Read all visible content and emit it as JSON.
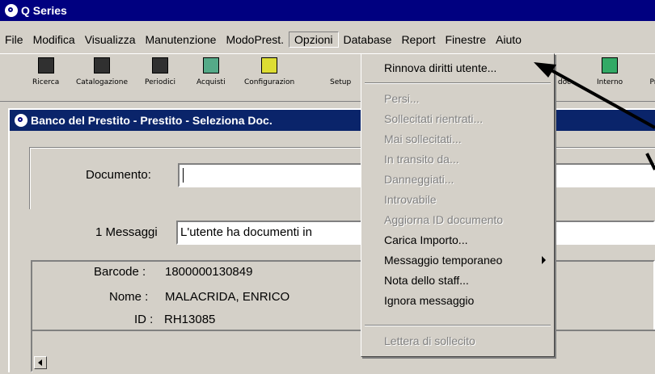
{
  "window": {
    "title": "Q Series"
  },
  "menubar": [
    "File",
    "Modifica",
    "Visualizza",
    "Manutenzione",
    "ModoPrest.",
    "Opzioni",
    "Database",
    "Report",
    "Finestre",
    "Aiuto"
  ],
  "toolbar": {
    "buttons": [
      "Ricerca",
      "Catalogazione",
      "Periodici",
      "Acquisti",
      "Configurazion",
      "Setup",
      "doc",
      "Interno",
      "Pr"
    ]
  },
  "child_window": {
    "title": "Banco del Prestito - Prestito - Seleziona Doc."
  },
  "form": {
    "documento_label": "Documento:",
    "documento_value": "",
    "messaggi_label": "1 Messaggi",
    "messaggi_value": "L'utente ha documenti in"
  },
  "patron": {
    "barcode_label": "Barcode :",
    "barcode_value": "1800000130849",
    "nome_label": "Nome :",
    "nome_value": "MALACRIDA, ENRICO",
    "id_label": "ID :",
    "id_value": "RH13085"
  },
  "opzioni_menu": {
    "items": [
      {
        "label": "Rinnova diritti utente...",
        "disabled": false
      },
      {
        "label": "Persi...",
        "disabled": true
      },
      {
        "label": "Sollecitati rientrati...",
        "disabled": true
      },
      {
        "label": "Mai sollecitati...",
        "disabled": true
      },
      {
        "label": "In transito da...",
        "disabled": true
      },
      {
        "label": "Danneggiati...",
        "disabled": true
      },
      {
        "label": "Introvabile",
        "disabled": true
      },
      {
        "label": "Aggiorna ID documento",
        "disabled": true
      },
      {
        "label": "Carica Importo...",
        "disabled": false
      },
      {
        "label": "Messaggio temporaneo",
        "disabled": false
      },
      {
        "label": "Nota dello staff...",
        "disabled": false
      },
      {
        "label": "Ignora messaggio",
        "disabled": false
      },
      {
        "label": "Lettera di sollecito",
        "disabled": true
      }
    ]
  }
}
